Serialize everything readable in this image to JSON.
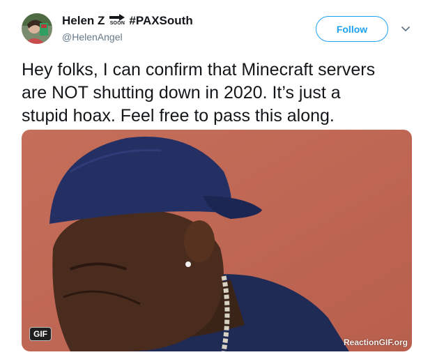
{
  "author": {
    "name": "Helen Z",
    "badge_text": "SOON",
    "hashtag": "#PAXSouth",
    "handle": "@HelenAngel"
  },
  "actions": {
    "follow_label": "Follow"
  },
  "tweet": {
    "text": "Hey folks, I can confirm that Minecraft servers\nare NOT shutting down in 2020. It’s just a\nstupid hoax. Feel free to pass this along."
  },
  "media": {
    "type_badge": "GIF",
    "watermark": "ReactionGIF.org"
  },
  "colors": {
    "accent": "#1da1f2",
    "text": "#14171a",
    "secondary": "#657786"
  },
  "icons": [
    "avatar",
    "soon-arrow-icon",
    "chevron-down-icon"
  ]
}
